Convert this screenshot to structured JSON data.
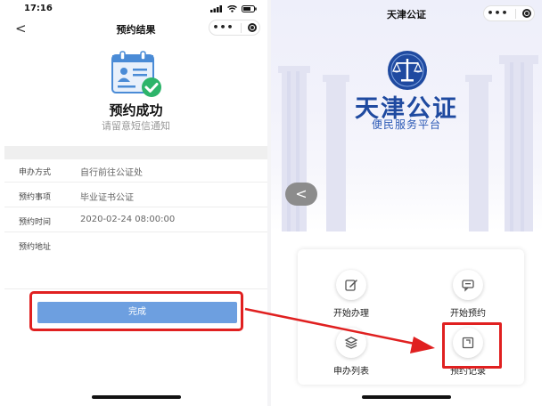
{
  "left_screen": {
    "status_time": "17:16",
    "nav_title": "预约结果",
    "back_glyph": "<",
    "result": {
      "title": "预约成功",
      "subtitle": "请留意短信通知"
    },
    "details": [
      {
        "label": "申办方式",
        "value": "自行前往公证处"
      },
      {
        "label": "预约事项",
        "value": "毕业证书公证"
      },
      {
        "label": "预约时间",
        "value": "2020-02-24 08:00:00"
      },
      {
        "label": "预约地址",
        "value": ""
      }
    ],
    "done_button": "完成"
  },
  "right_screen": {
    "nav_title": "天津公证",
    "brand": {
      "name": "天津公证",
      "subtitle": "便民服务平台"
    },
    "side_arrow_glyph": "<",
    "menu": [
      {
        "label": "开始办理",
        "icon": "edit-icon"
      },
      {
        "label": "开始预约",
        "icon": "chat-icon"
      },
      {
        "label": "申办列表",
        "icon": "layers-icon"
      },
      {
        "label": "预约记录",
        "icon": "record-icon"
      }
    ]
  },
  "colors": {
    "accent_button": "#6d9fe0",
    "highlight": "#e02020",
    "brand_blue": "#1f4aa0",
    "success_green": "#2db46a"
  }
}
